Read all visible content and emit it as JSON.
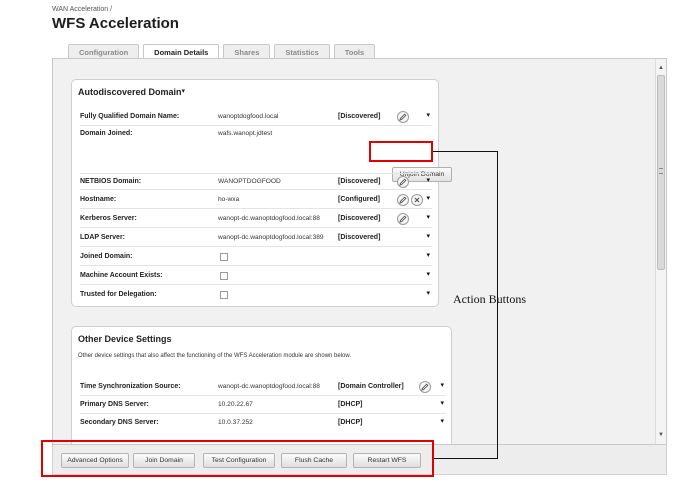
{
  "breadcrumb": "WAN Acceleration /",
  "page_title": "WFS Acceleration",
  "tabs": [
    {
      "label": "Configuration",
      "active": false
    },
    {
      "label": "Domain Details",
      "active": true
    },
    {
      "label": "Shares",
      "active": false
    },
    {
      "label": "Statistics",
      "active": false
    },
    {
      "label": "Tools",
      "active": false
    }
  ],
  "autodiscovered": {
    "title": "Autodiscovered Domain",
    "title_mark": "▾",
    "rows": [
      {
        "label": "Fully Qualified Domain Name:",
        "value": "wanoptdogfood.local",
        "status": "[Discovered]"
      },
      {
        "label": "Domain Joined:",
        "value": "wafs.wanopt.jdtest"
      },
      {
        "label": "NETBIOS Domain:",
        "value": "WANOPTDOGFOOD",
        "status": "[Discovered]"
      },
      {
        "label": "Hostname:",
        "value": "ho-wxa",
        "status": "[Configured]"
      },
      {
        "label": "Kerberos Server:",
        "value": "wanopt-dc.wanoptdogfood.local:88",
        "status": "[Discovered]"
      },
      {
        "label": "LDAP Server:",
        "value": "wanopt-dc.wanoptdogfood.local:389",
        "status": "[Discovered]"
      },
      {
        "label": "Joined Domain:"
      },
      {
        "label": "Machine Account Exists:"
      },
      {
        "label": "Trusted for Delegation:"
      }
    ],
    "unjoin_button": "Unjoin Domain"
  },
  "other": {
    "title": "Other Device Settings",
    "description": "Other device settings that also affect the functioning of the WFS Acceleration module are shown below.",
    "rows": [
      {
        "label": "Time Synchronization Source:",
        "value": "wanopt-dc.wanoptdogfood.local:88",
        "status": "[Domain Controller]"
      },
      {
        "label": "Primary DNS Server:",
        "value": "10.20.22.67",
        "status": "[DHCP]"
      },
      {
        "label": "Secondary DNS Server:",
        "value": "10.0.37.252",
        "status": "[DHCP]"
      }
    ]
  },
  "actions": {
    "advanced": "Advanced Options",
    "join": "Join Domain",
    "test": "Test Configuration",
    "flush": "Flush Cache",
    "restart": "Restart WFS"
  },
  "callout": "Action Buttons",
  "row_tick": "▾",
  "icons": {
    "edit": "pencil-icon",
    "clear": "close-icon"
  },
  "colors": {
    "highlight": "#e00000",
    "panel_border": "#cfcfcf"
  }
}
